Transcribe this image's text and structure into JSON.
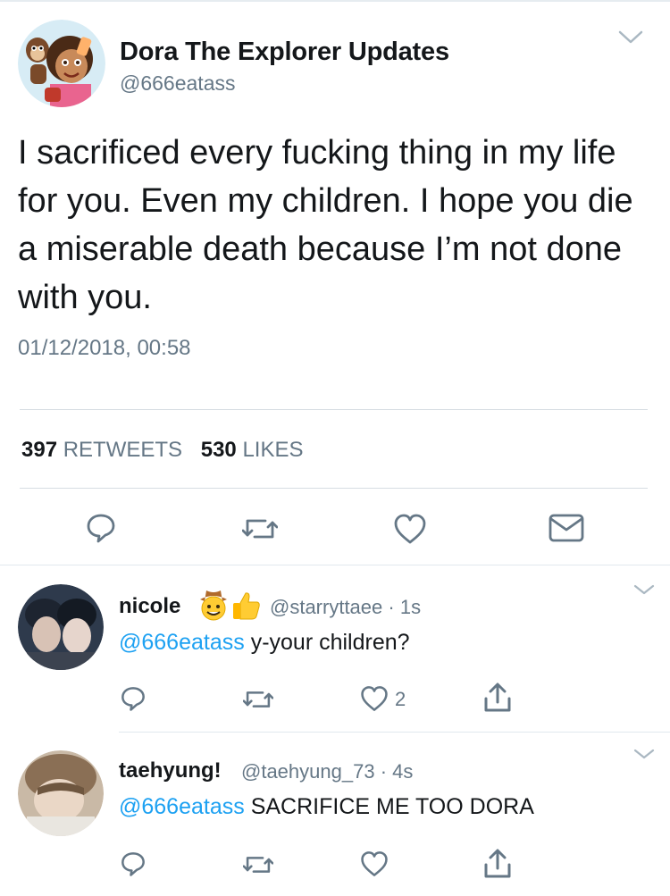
{
  "tweet": {
    "display_name": "Dora The Explorer Updates",
    "handle": "@666eatass",
    "text": "I sacrificed every fucking thing in my life for you. Even my children. I hope you die a miserable death because I’m not done with you.",
    "timestamp": "01/12/2018, 00:58",
    "retweet_count": "397",
    "retweet_label": "RETWEETS",
    "like_count": "530",
    "like_label": "LIKES"
  },
  "replies": [
    {
      "display_name": "nicole",
      "name_emojis": [
        "cowboy-face",
        "thumbs-up"
      ],
      "handle": "@starryttaee",
      "separator": "·",
      "time": "1s",
      "mention": "@666eatass",
      "text": " y-your children?",
      "like_count": "2"
    },
    {
      "display_name": "taehyung!",
      "handle": "@taehyung_73",
      "separator": "·",
      "time": "4s",
      "mention": "@666eatass",
      "text": " SACRIFICE ME TOO DORA",
      "like_count": ""
    }
  ],
  "icons": {
    "reply": "speech-bubble-icon",
    "retweet": "retweet-arrows-icon",
    "like": "heart-icon",
    "message": "envelope-icon",
    "share": "share-upload-icon",
    "menu": "chevron-down-icon"
  },
  "colors": {
    "text": "#14171a",
    "secondary": "#657786",
    "link": "#1da1f2",
    "divider": "#e1e8ed"
  }
}
